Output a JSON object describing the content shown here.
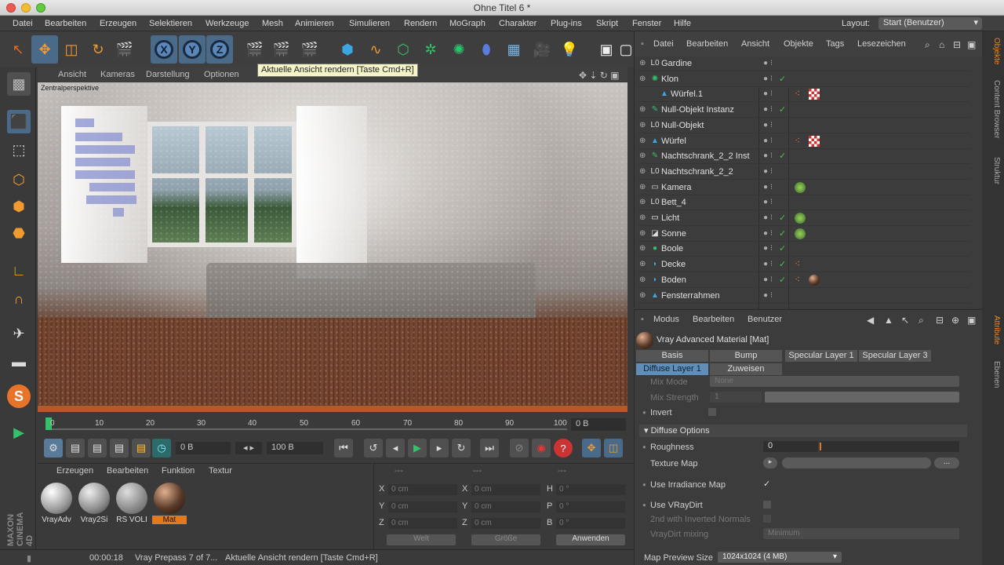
{
  "window": {
    "title": "Ohne Titel 6 *"
  },
  "menubar": {
    "items": [
      "Datei",
      "Bearbeiten",
      "Erzeugen",
      "Selektieren",
      "Werkzeuge",
      "Mesh",
      "Animieren",
      "Simulieren",
      "Rendern",
      "MoGraph",
      "Charakter",
      "Plug-ins",
      "Skript",
      "Fenster",
      "Hilfe"
    ],
    "layout_label": "Layout:",
    "layout_value": "Start (Benutzer)"
  },
  "toolbar": {
    "axis_x": "X",
    "axis_y": "Y",
    "axis_z": "Z",
    "tooltip": "Aktuelle Ansicht rendern [Taste Cmd+R]"
  },
  "viewport": {
    "menu": [
      "Ansicht",
      "Kameras",
      "Darstellung",
      "Optionen"
    ],
    "label": "Zentralperspektive"
  },
  "timeline": {
    "ticks": [
      "0",
      "10",
      "20",
      "30",
      "40",
      "50",
      "60",
      "70",
      "80",
      "90",
      "100"
    ],
    "current_frame": "0 B"
  },
  "transport": {
    "start_frame": "0 B",
    "end_frame": "100 B"
  },
  "material_manager": {
    "menu": [
      "Erzeugen",
      "Bearbeiten",
      "Funktion",
      "Textur"
    ],
    "materials": [
      {
        "label": "VrayAdv",
        "color": "#c9c9c9"
      },
      {
        "label": "Vray2Si",
        "color": "#bdbdbd"
      },
      {
        "label": "RS VOLI",
        "color": "#aaaaaa"
      },
      {
        "label": "Mat",
        "color": "#5a3a28"
      }
    ]
  },
  "coordinates": {
    "headers": [
      "---",
      "---",
      "---"
    ],
    "rows": [
      {
        "a": "X",
        "av": "0 cm",
        "b": "X",
        "bv": "0 cm",
        "c": "H",
        "cv": "0 °"
      },
      {
        "a": "Y",
        "av": "0 cm",
        "b": "Y",
        "bv": "0 cm",
        "c": "P",
        "cv": "0 °"
      },
      {
        "a": "Z",
        "av": "0 cm",
        "b": "Z",
        "bv": "0 cm",
        "c": "B",
        "cv": "0 °"
      }
    ],
    "mode_left": "Welt",
    "mode_right": "Größe",
    "apply": "Anwenden"
  },
  "statusbar": {
    "time": "00:00:18",
    "text": "Vray Prepass 7 of 7...",
    "hint": "Aktuelle Ansicht rendern [Taste Cmd+R]"
  },
  "object_manager": {
    "menu": [
      "Datei",
      "Bearbeiten",
      "Ansicht",
      "Objekte",
      "Tags",
      "Lesezeichen"
    ],
    "objects": [
      {
        "name": "Gardine",
        "icon": "null",
        "check": false,
        "tags": []
      },
      {
        "name": "Klon",
        "icon": "cloner",
        "check": true,
        "tags": []
      },
      {
        "name": "Würfel.1",
        "icon": "cube",
        "check": false,
        "tags": [
          "phong",
          "checker"
        ],
        "indent": true
      },
      {
        "name": "Null-Objekt Instanz",
        "icon": "instance",
        "check": true,
        "tags": []
      },
      {
        "name": "Null-Objekt",
        "icon": "null",
        "check": false,
        "tags": []
      },
      {
        "name": "Würfel",
        "icon": "cube",
        "check": false,
        "tags": [
          "phong",
          "checker"
        ]
      },
      {
        "name": "Nachtschrank_2_2 Inst",
        "icon": "instance",
        "check": true,
        "tags": []
      },
      {
        "name": "Nachtschrank_2_2",
        "icon": "null",
        "check": false,
        "tags": []
      },
      {
        "name": "Kamera",
        "icon": "camera",
        "check": false,
        "tags": [
          "target"
        ]
      },
      {
        "name": "Bett_4",
        "icon": "null",
        "check": false,
        "tags": []
      },
      {
        "name": "Licht",
        "icon": "light",
        "check": true,
        "tags": [
          "target"
        ]
      },
      {
        "name": "Sonne",
        "icon": "sun",
        "check": true,
        "tags": [
          "target"
        ]
      },
      {
        "name": "Boole",
        "icon": "boole",
        "check": true,
        "tags": []
      },
      {
        "name": "Decke",
        "icon": "plane",
        "check": true,
        "tags": [
          "phong"
        ]
      },
      {
        "name": "Boden",
        "icon": "plane",
        "check": true,
        "tags": [
          "phong",
          "material"
        ]
      },
      {
        "name": "Fensterrahmen",
        "icon": "cube",
        "check": false,
        "tags": []
      }
    ]
  },
  "attribute_manager": {
    "menu": [
      "Modus",
      "Bearbeiten",
      "Benutzer"
    ],
    "material_title": "Vray Advanced Material [Mat]",
    "tabs_row1": [
      "Basis",
      "Bump",
      "Specular Layer 1",
      "Specular Layer 3"
    ],
    "tabs_row2": [
      "Diffuse Layer 1",
      "Zuweisen"
    ],
    "mix_mode_label": "Mix Mode",
    "mix_mode_value": "None",
    "mix_strength_label": "Mix Strength",
    "mix_strength_value": "1",
    "invert_label": "Invert",
    "section_diffuse": "Diffuse Options",
    "roughness_label": "Roughness",
    "roughness_value": "0",
    "texture_map_label": "Texture Map",
    "texture_more": "...",
    "use_irradiance_label": "Use Irradiance Map",
    "use_vraydirt_label": "Use VRayDirt",
    "inverted_normals_label": "2nd with Inverted Normals",
    "vraydirt_mixing_label": "VrayDirt mixing",
    "vraydirt_mixing_value": "Minimum",
    "map_preview_label": "Map Preview Size",
    "map_preview_value": "1024x1024 (4 MB)"
  },
  "side_tabs": [
    "Objekte",
    "Content Browser",
    "Struktur",
    "Attribute",
    "Ebenen"
  ],
  "branding": {
    "maxon": "MAXON",
    "cinema": "CINEMA 4D"
  },
  "colors": {
    "accent": "#e07a20",
    "selection_blue": "#5f8fb8",
    "check_green": "#4ec24e"
  }
}
